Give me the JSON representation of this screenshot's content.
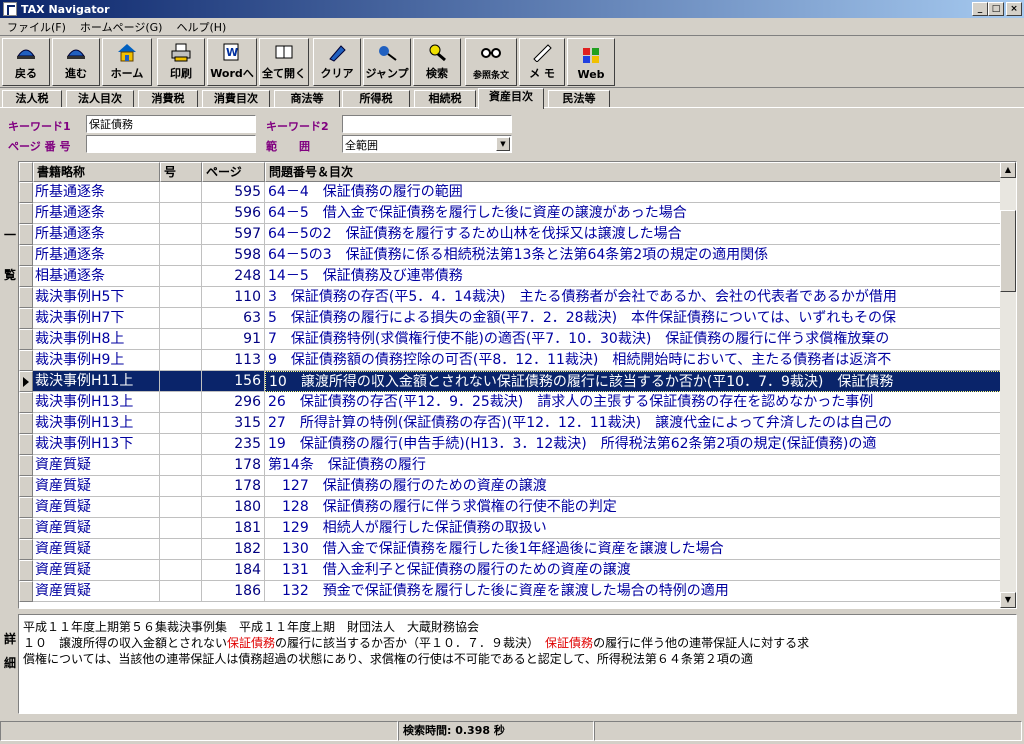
{
  "window": {
    "title": "TAX Navigator",
    "min": "_",
    "max": "□",
    "close": "×"
  },
  "menu": [
    "ファイル(F)",
    "ホームページ(G)",
    "ヘルプ(H)"
  ],
  "toolbar": [
    {
      "label": "戻る",
      "icon": "back-icon"
    },
    {
      "label": "進む",
      "icon": "forward-icon"
    },
    {
      "label": "ホーム",
      "icon": "home-icon"
    },
    {
      "label": "印刷",
      "icon": "print-icon"
    },
    {
      "label": "Wordへ",
      "icon": "word-icon"
    },
    {
      "label": "全て開く",
      "icon": "expand-all-icon"
    },
    {
      "label": "クリア",
      "icon": "clear-icon"
    },
    {
      "label": "ジャンプ",
      "icon": "jump-icon"
    },
    {
      "label": "検索",
      "icon": "search-icon"
    },
    {
      "label": "参照条文",
      "icon": "reference-icon"
    },
    {
      "label": "メ モ",
      "icon": "memo-icon"
    },
    {
      "label": "Web",
      "icon": "web-icon"
    }
  ],
  "tabs": [
    "法人税",
    "法人目次",
    "消費税",
    "消費目次",
    "商法等",
    "所得税",
    "相続税",
    "資産目次",
    "民法等"
  ],
  "active_tab": "資産目次",
  "search": {
    "keyword1_label": "キーワード1",
    "keyword1_value": "保証債務",
    "keyword2_label": "キーワード2",
    "keyword2_value": "",
    "page_label": "ページ 番 号",
    "page_value": "",
    "range_label": "範　　囲",
    "range_value": "全範囲"
  },
  "side_labels": {
    "list": [
      "一",
      "覧"
    ],
    "detail": [
      "詳",
      "細"
    ]
  },
  "grid": {
    "columns": [
      "書籍略称",
      "号",
      "ページ",
      "問題番号＆目次"
    ],
    "rows": [
      {
        "book": "所基通逐条",
        "no": "",
        "page": "595",
        "title": "64－4　保証債務の履行の範囲"
      },
      {
        "book": "所基通逐条",
        "no": "",
        "page": "596",
        "title": "64－5　借入金で保証債務を履行した後に資産の譲渡があった場合"
      },
      {
        "book": "所基通逐条",
        "no": "",
        "page": "597",
        "title": "64－5の2　保証債務を履行するため山林を伐採又は譲渡した場合"
      },
      {
        "book": "所基通逐条",
        "no": "",
        "page": "598",
        "title": "64－5の3　保証債務に係る相続税法第13条と法第64条第2項の規定の適用関係"
      },
      {
        "book": "相基通逐条",
        "no": "",
        "page": "248",
        "title": "14－5　保証債務及び連帯債務"
      },
      {
        "book": "裁決事例H5下",
        "no": "",
        "page": "110",
        "title": "3　保証債務の存否(平5．4．14裁決)　主たる債務者が会社であるか、会社の代表者であるかが借用"
      },
      {
        "book": "裁決事例H7下",
        "no": "",
        "page": "63",
        "title": "5　保証債務の履行による損失の金額(平7．2．28裁決)　本件保証債務については、いずれもその保"
      },
      {
        "book": "裁決事例H8上",
        "no": "",
        "page": "91",
        "title": "7　保証債務特例(求償権行使不能)の適否(平7．10．30裁決)　保証債務の履行に伴う求償権放棄の"
      },
      {
        "book": "裁決事例H9上",
        "no": "",
        "page": "113",
        "title": "9　保証債務額の債務控除の可否(平8．12．11裁決)　相続開始時において、主たる債務者は返済不"
      },
      {
        "book": "裁決事例H11上",
        "no": "",
        "page": "156",
        "title": "10　譲渡所得の収入金額とされない保証債務の履行に該当するか否か(平10．7．9裁決)　保証債務"
      },
      {
        "book": "裁決事例H13上",
        "no": "",
        "page": "296",
        "title": "26　保証債務の存否(平12．9．25裁決)　請求人の主張する保証債務の存在を認めなかった事例"
      },
      {
        "book": "裁決事例H13上",
        "no": "",
        "page": "315",
        "title": "27　所得計算の特例(保証債務の存否)(平12．12．11裁決)　譲渡代金によって弁済したのは自己の"
      },
      {
        "book": "裁決事例H13下",
        "no": "",
        "page": "235",
        "title": "19　保証債務の履行(申告手続)(H13．3．12裁決)　所得税法第62条第2項の規定(保証債務)の適"
      },
      {
        "book": "資産質疑",
        "no": "",
        "page": "178",
        "title": "第14条　保証債務の履行"
      },
      {
        "book": "資産質疑",
        "no": "",
        "page": "178",
        "title": "　127　保証債務の履行のための資産の譲渡"
      },
      {
        "book": "資産質疑",
        "no": "",
        "page": "180",
        "title": "　128　保証債務の履行に伴う求償権の行使不能の判定"
      },
      {
        "book": "資産質疑",
        "no": "",
        "page": "181",
        "title": "　129　相続人が履行した保証債務の取扱い"
      },
      {
        "book": "資産質疑",
        "no": "",
        "page": "182",
        "title": "　130　借入金で保証債務を履行した後1年経過後に資産を譲渡した場合"
      },
      {
        "book": "資産質疑",
        "no": "",
        "page": "184",
        "title": "　131　借入金利子と保証債務の履行のための資産の譲渡"
      },
      {
        "book": "資産質疑",
        "no": "",
        "page": "186",
        "title": "　132　預金で保証債務を履行した後に資産を譲渡した場合の特例の適用"
      }
    ],
    "selected_index": 9
  },
  "detail": {
    "line1": "平成１１年度上期第５６集裁決事例集　平成１１年度上期　財団法人　大蔵財務協会",
    "line2_a": "１０　譲渡所得の収入金額とされない",
    "highlight": "保証債務",
    "line2_b": "の履行に該当するか否か（平１０．７．９裁決）　",
    "line2_c": "の履行に伴う他の連帯保証人に対する求",
    "line3": "償権については、当該他の連帯保証人は債務超過の状態にあり、求償権の行使は不可能であると認定して、所得税法第６４条第２項の適"
  },
  "status": {
    "search_time": "検索時間:  0.398 秒"
  },
  "colors": {
    "link_text": "#0000a0",
    "selection": "#0a246a",
    "label": "#800080",
    "highlight": "#e00000"
  }
}
